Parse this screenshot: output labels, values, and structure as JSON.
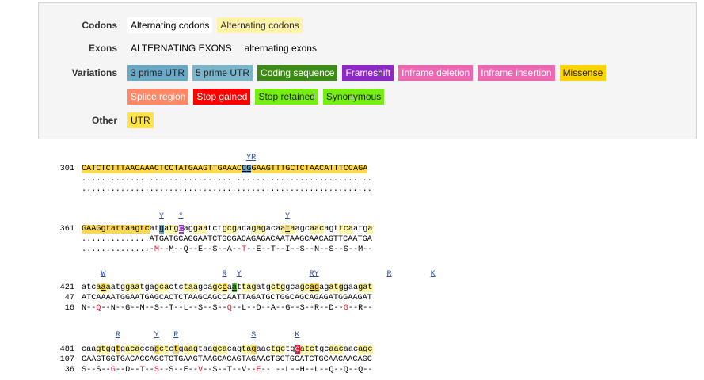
{
  "legend": {
    "codons": {
      "label": "Codons",
      "a": "Alternating codons",
      "b": "Alternating codons"
    },
    "exons": {
      "label": "Exons",
      "a": "ALTERNATING EXONS",
      "b": "alternating exons"
    },
    "variations": {
      "label": "Variations",
      "keys": [
        {
          "text": "3 prime UTR",
          "bg": "#6aa8c8",
          "fg": "#222"
        },
        {
          "text": "5 prime UTR",
          "bg": "#7ab6cb",
          "fg": "#222"
        },
        {
          "text": "Coding sequence",
          "bg": "#3d8b17",
          "fg": "#fff"
        },
        {
          "text": "Frameshift",
          "bg": "#8e28c4",
          "fg": "#fff"
        },
        {
          "text": "Inframe deletion",
          "bg": "#ec68b2",
          "fg": "#fff"
        },
        {
          "text": "Inframe insertion",
          "bg": "#ec68b2",
          "fg": "#fff"
        },
        {
          "text": "Missense",
          "bg": "#ffd400",
          "fg": "#222"
        },
        {
          "text": "Splice region",
          "bg": "#ff8866",
          "fg": "#fff"
        },
        {
          "text": "Stop gained",
          "bg": "#ff0000",
          "fg": "#fff"
        },
        {
          "text": "Stop retained",
          "bg": "#77ee11",
          "fg": "#222"
        },
        {
          "text": "Synonymous",
          "bg": "#77ee11",
          "fg": "#222"
        }
      ]
    },
    "other": {
      "label": "Other",
      "keys": [
        {
          "text": "UTR",
          "bg": "#ffe34a",
          "fg": "#222"
        }
      ]
    }
  },
  "blocks": [
    {
      "num": "301",
      "ann": "YR",
      "seq": "CATCTCTTTAACAAACTCCTATGAAGTTGAAACCGGAAGTTTGCTCTAACATTTCCAGA",
      "l2": "............................................................",
      "l3": "............................................................"
    },
    {
      "num": "361",
      "ann1": "Y",
      "ann2": "*",
      "ann3": "Y",
      "seq": "GAAGgtattaagtcatgatgcaggaatctgcgacagagacaataagcaacagttcaatga",
      "l2": "..............ATGATGCAGGAATCTGCGACAGAGACAATAAGCAACAGTTCAATGA",
      "l3": "..............-M--M--Q--E--S--A--T--E--T--I--S--N--S--S--M--"
    },
    {
      "num": "421",
      "num2": "47",
      "num3": "16",
      "anns": [
        "W",
        "R",
        "Y",
        "RY",
        "R",
        "K"
      ],
      "seq": "atcaaaatggaatgagcactctaagcagccaattagatgctggcagcagagatggaagat",
      "l2": "ATCAAAATGGAATGAGCACTCTAAGCAGCCAATTAGATGCTGGCAGCAGAGATGGAAGAT",
      "l3": "N--Q--N--G--M--S--T--L--S--S--Q--L--D--A--G--S--R--D--G--R--"
    },
    {
      "num": "481",
      "num2": "107",
      "num3": "36",
      "anns": [
        "R",
        "Y",
        "R",
        "S",
        "K"
      ],
      "seq": "caagtggtgacaccagctctgaagtaagcacagtagaactgctgcatctgcaacaacagc",
      "l2": "CAAGTGGTGACACCAGCTCTGAAGTAAGCACAGTAGAACTGCTGCATCTGCAACAACAGC",
      "l3": "S--S--G--D--T--S--S--E--V--S--T--V--E--L--L--H--L--Q--Q--Q--"
    }
  ]
}
